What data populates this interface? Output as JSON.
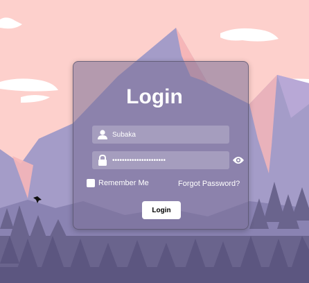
{
  "login": {
    "title": "Login",
    "username_value": "Subaka",
    "password_value": "••••••••••••••••••••••",
    "remember_label": "Remember Me",
    "forgot_label": "Forgot Password?",
    "submit_label": "Login"
  },
  "icons": {
    "username": "user-icon",
    "password": "lock-icon",
    "toggle_password": "eye-icon"
  },
  "colors": {
    "sky": "#fdd0cc",
    "mountain": "#a49cc8",
    "mountain_highlight": "#f6b6b8",
    "forest": "#6a648d",
    "card": "#786e96"
  }
}
